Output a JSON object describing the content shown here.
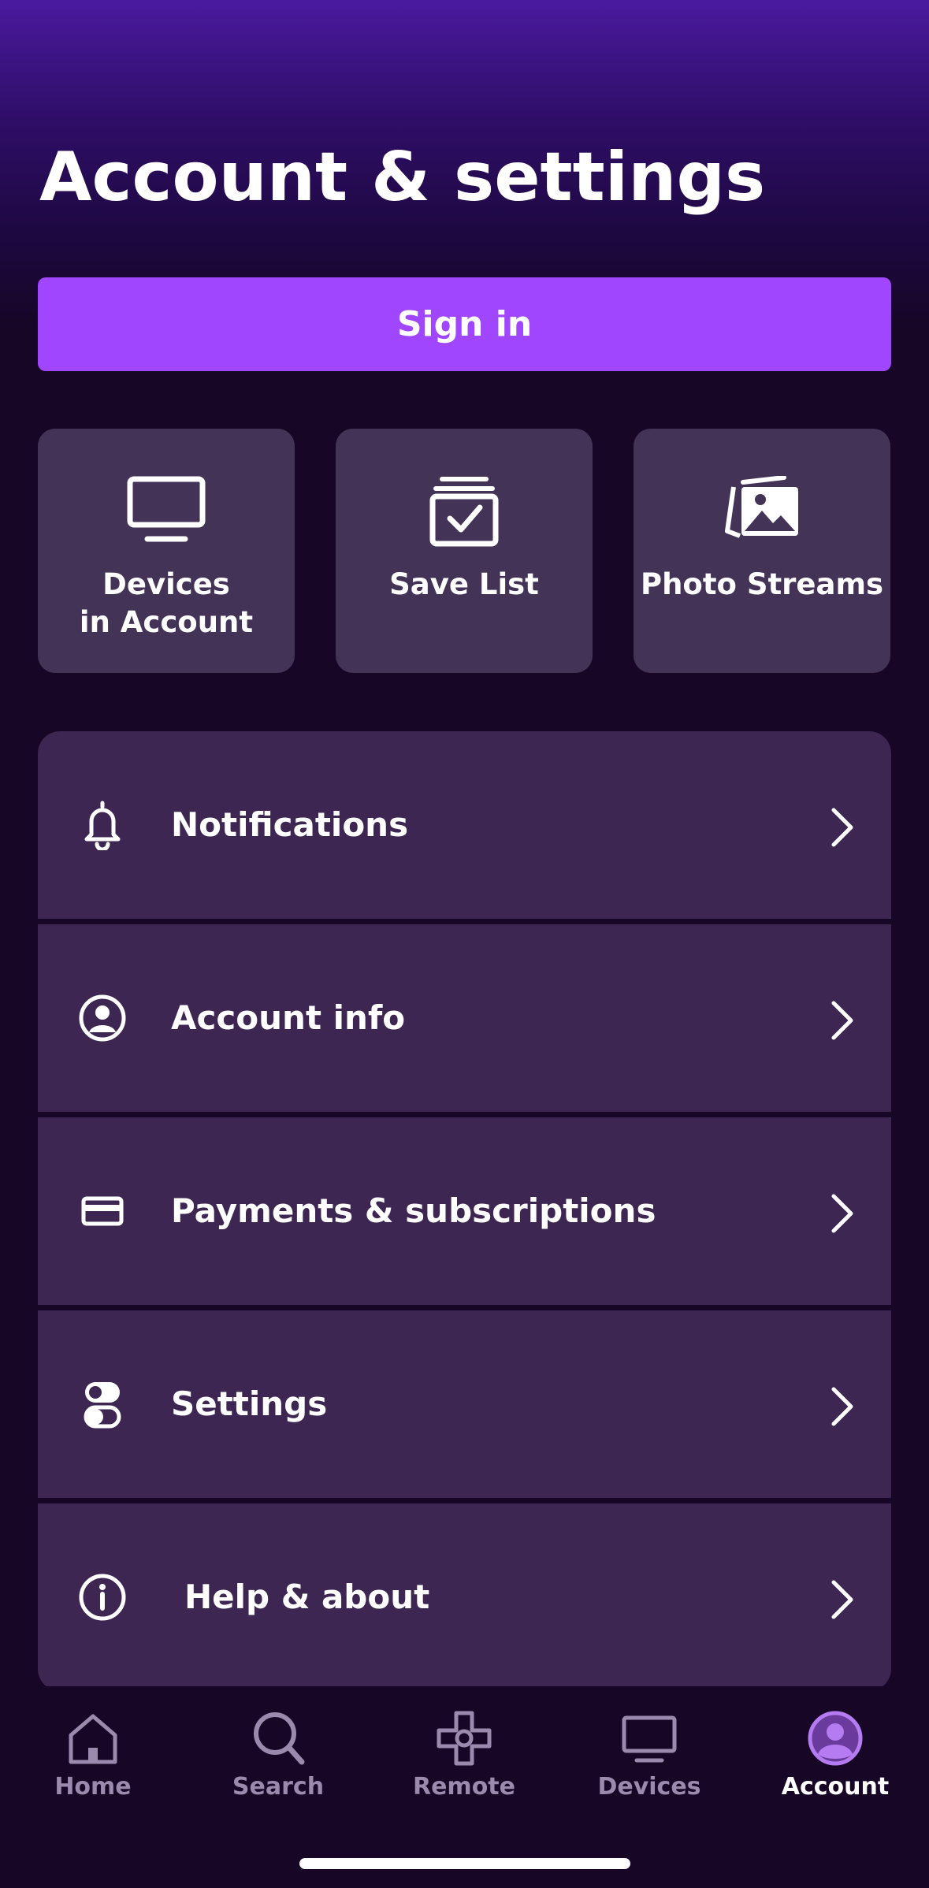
{
  "header": {
    "title": "Account & settings"
  },
  "sign_in": {
    "label": "Sign in",
    "color": "#a046ff"
  },
  "tiles": [
    {
      "label": "Devices\nin Account",
      "icon": "tv-icon"
    },
    {
      "label": "Save List",
      "icon": "save-list-icon"
    },
    {
      "label": "Photo Streams",
      "icon": "photo-streams-icon"
    }
  ],
  "menu": {
    "items": [
      {
        "label": "Notifications",
        "icon": "bell-icon"
      },
      {
        "label": "Account info",
        "icon": "account-circle-icon"
      },
      {
        "label": "Payments & subscriptions",
        "icon": "credit-card-icon"
      },
      {
        "label": "Settings",
        "icon": "toggles-icon"
      },
      {
        "label": "Help & about",
        "icon": "info-icon"
      }
    ]
  },
  "bottom_nav": {
    "active": "Account",
    "items": [
      {
        "label": "Home",
        "icon": "home-icon"
      },
      {
        "label": "Search",
        "icon": "search-icon"
      },
      {
        "label": "Remote",
        "icon": "remote-icon"
      },
      {
        "label": "Devices",
        "icon": "tv-icon"
      },
      {
        "label": "Account",
        "icon": "account-icon"
      }
    ]
  },
  "colors": {
    "background": "#170626",
    "header_gradient_top": "#4a1a9e",
    "tile_bg": "#433357",
    "row_bg": "#3d2752",
    "nav_inactive": "#9b8aae",
    "nav_active_icon": "#b57cf2"
  }
}
